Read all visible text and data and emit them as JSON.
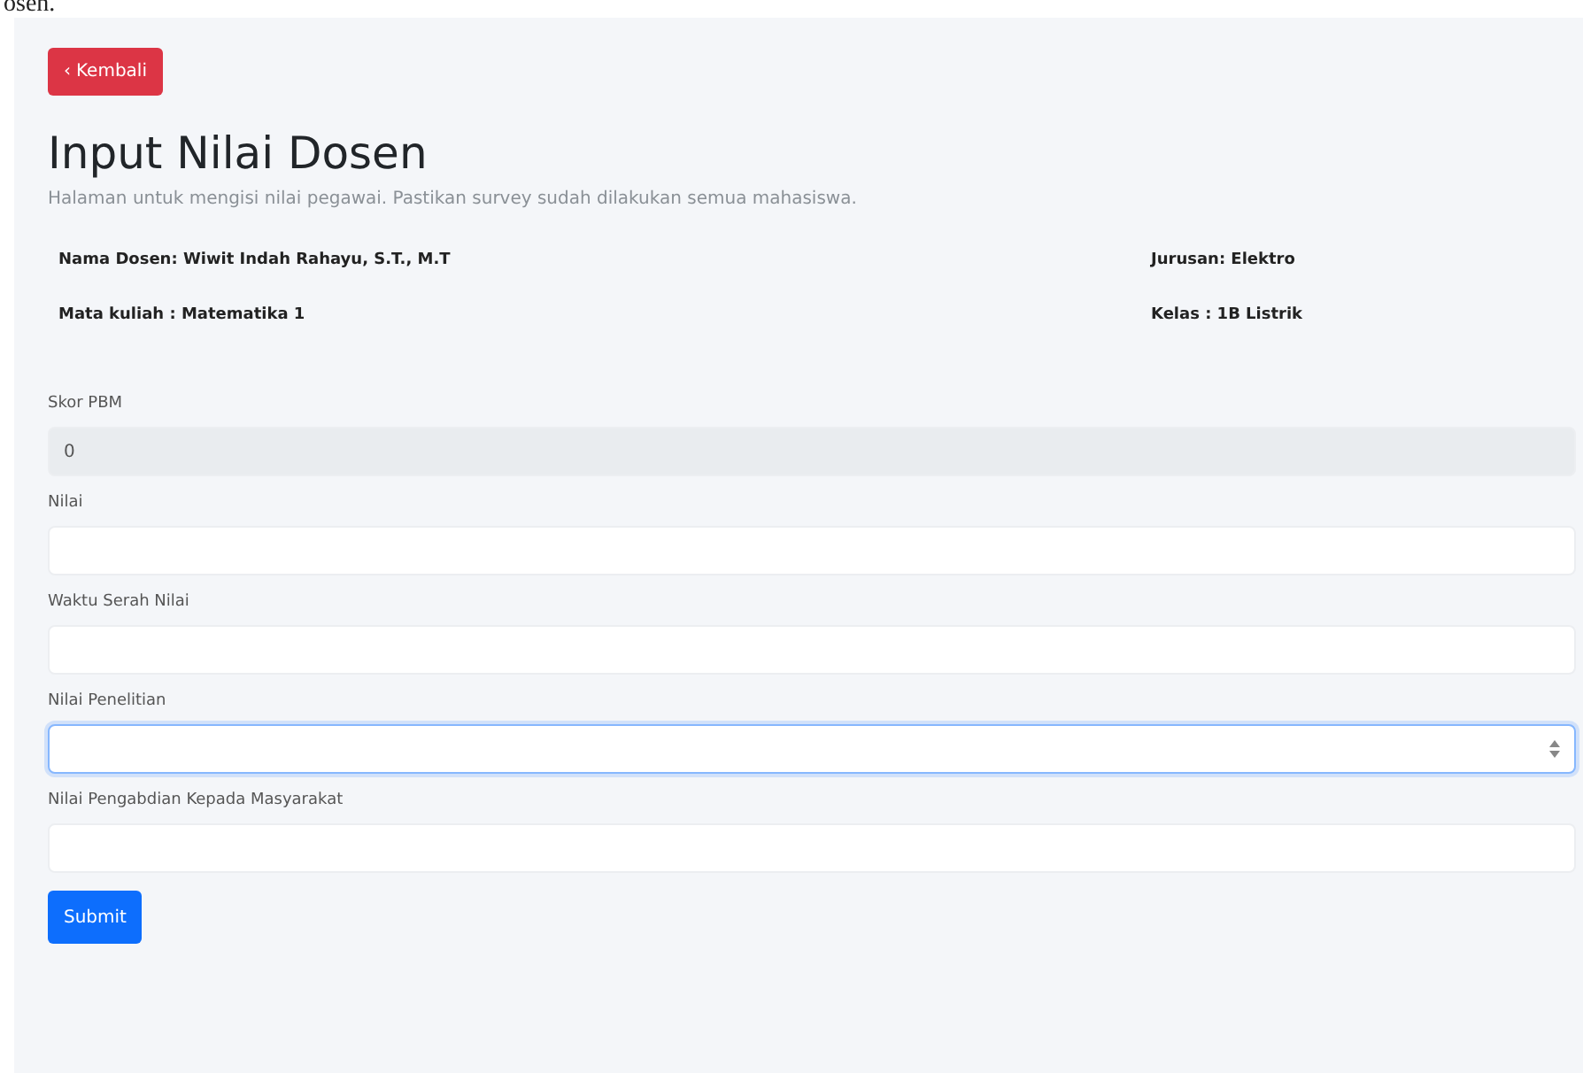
{
  "top_fragment": "osen.",
  "back_button": {
    "icon": "‹",
    "label": "Kembali"
  },
  "title": "Input Nilai Dosen",
  "subtitle": "Halaman untuk mengisi nilai pegawai. Pastikan survey sudah dilakukan semua mahasiswa.",
  "info": [
    {
      "left": "Nama Dosen: Wiwit Indah Rahayu, S.T., M.T",
      "right": "Jurusan: Elektro"
    },
    {
      "left": "Mata kuliah : Matematika 1",
      "right": "Kelas : 1B Listrik"
    }
  ],
  "fields": [
    {
      "label": "Skor PBM",
      "value": "0",
      "disabled": true,
      "focused": false,
      "kind": "text"
    },
    {
      "label": "Nilai",
      "disabled": false,
      "focused": false,
      "kind": "text"
    },
    {
      "label": "Waktu Serah Nilai",
      "disabled": false,
      "focused": false,
      "kind": "text"
    },
    {
      "label": "Nilai Penelitian",
      "disabled": false,
      "focused": true,
      "kind": "number"
    },
    {
      "label": "Nilai Pengabdian Kepada Masyarakat",
      "disabled": false,
      "focused": false,
      "kind": "text"
    }
  ],
  "submit_button": "Submit"
}
